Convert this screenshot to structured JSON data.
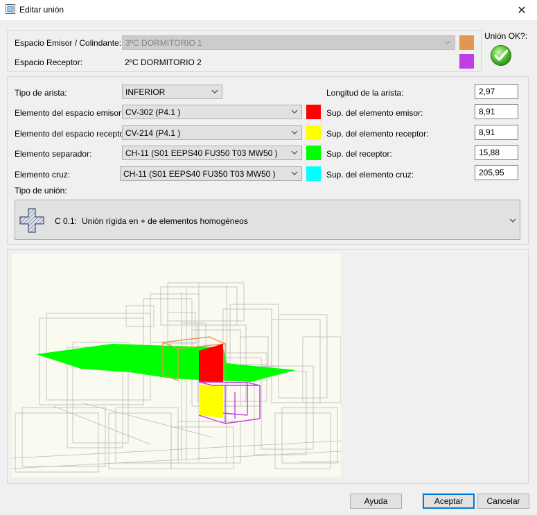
{
  "window": {
    "title": "Editar unión",
    "close_glyph": "✕"
  },
  "spaces": {
    "emitter_label": "Espacio Emisor / Colindante:",
    "emitter_value": "3ºC DORMITORIO 1",
    "emitter_color": "#e2964e",
    "receiver_label": "Espacio Receptor:",
    "receiver_value": "2ºC DORMITORIO 2",
    "receiver_color": "#bf3fe3"
  },
  "status": {
    "label": "Unión OK?:",
    "icon": "check-ok-icon"
  },
  "edge": {
    "label": "Tipo de arista:",
    "value": "INFERIOR"
  },
  "rows": [
    {
      "label": "Elemento del espacio emisor:",
      "value": "CV-302 (P4.1 )",
      "color": "#ff0000",
      "sup_label": "Sup. del elemento emisor:",
      "sup_value": "8,91"
    },
    {
      "label": "Elemento del espacio receptor:",
      "value": "CV-214 (P4.1 )",
      "color": "#ffff00",
      "sup_label": "Sup. del elemento receptor:",
      "sup_value": "8,91"
    },
    {
      "label": "Elemento separador:",
      "value": "CH-11 (S01 EEPS40 FU350 T03 MW50 )",
      "color": "#00ff00",
      "sup_label": "Sup. del receptor:",
      "sup_value": "15,88"
    },
    {
      "label": "Elemento cruz:",
      "value": "CH-11 (S01 EEPS40 FU350 T03 MW50 )",
      "color": "#00ffff",
      "sup_label": "Sup. del elemento cruz:",
      "sup_value": "205,95"
    }
  ],
  "length": {
    "label": "Longitud de la arista:",
    "value": "2,97"
  },
  "union_type": {
    "label": "Tipo de unión:",
    "code": "C 0.1:",
    "description": "Unión rígida en + de elementos homogéneos"
  },
  "buttons": {
    "help": "Ayuda",
    "accept": "Aceptar",
    "cancel": "Cancelar"
  }
}
